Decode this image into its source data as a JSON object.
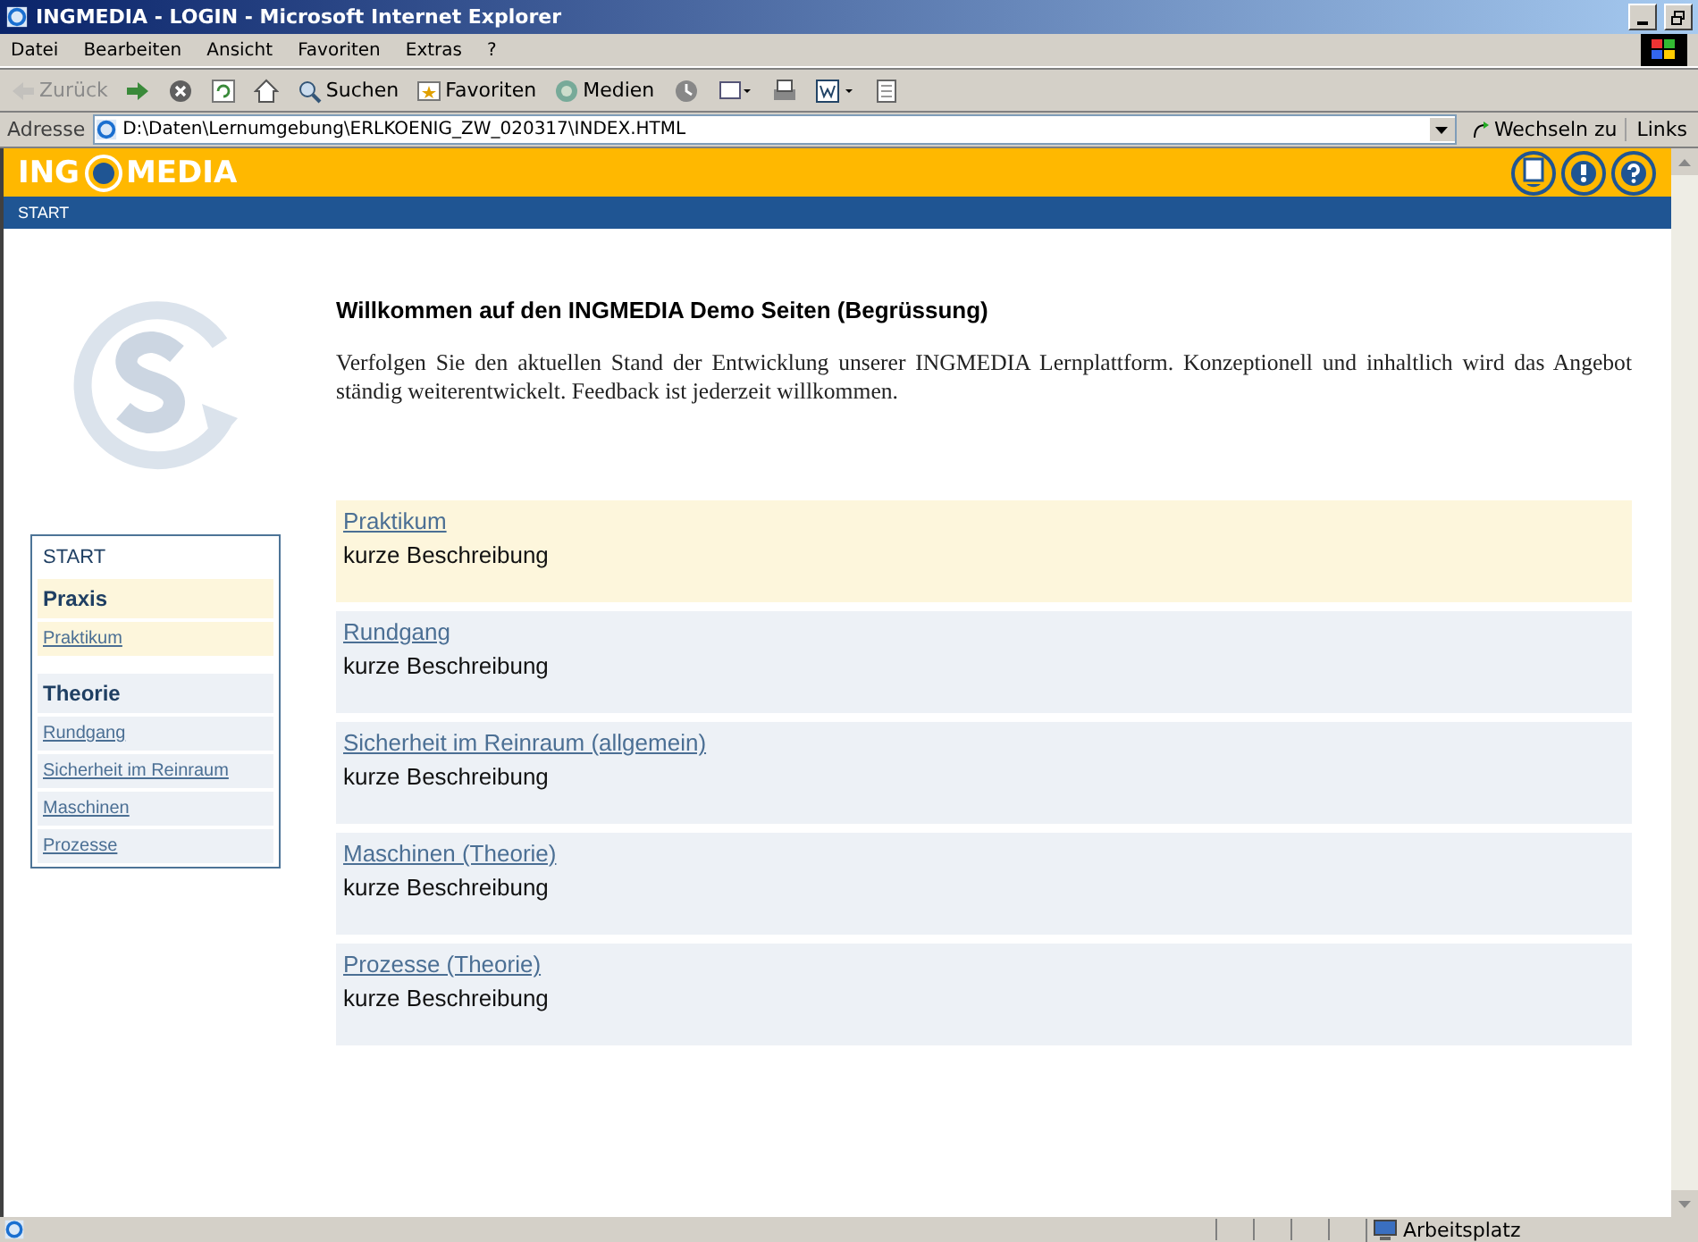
{
  "window": {
    "title": "INGMEDIA - LOGIN - Microsoft Internet Explorer"
  },
  "menu": [
    "Datei",
    "Bearbeiten",
    "Ansicht",
    "Favoriten",
    "Extras",
    "?"
  ],
  "toolbar": [
    {
      "kind": "back",
      "label": "Zurück",
      "disabled": true
    },
    {
      "kind": "forward",
      "disabled": false
    },
    {
      "kind": "stop",
      "disabled": false
    },
    {
      "kind": "refresh",
      "disabled": false
    },
    {
      "kind": "home",
      "disabled": false
    },
    {
      "kind": "search",
      "label": "Suchen",
      "disabled": false
    },
    {
      "kind": "favorites",
      "label": "Favoriten",
      "disabled": false
    },
    {
      "kind": "media",
      "label": "Medien",
      "disabled": false
    },
    {
      "kind": "history",
      "disabled": false
    },
    {
      "kind": "mail",
      "disabled": false
    },
    {
      "kind": "print",
      "disabled": false
    },
    {
      "kind": "word",
      "disabled": false
    },
    {
      "kind": "discuss",
      "disabled": false
    }
  ],
  "address_bar": {
    "label": "Adresse",
    "value": "D:\\Daten\\Lernumgebung\\ERLKOENIG_ZW_020317\\INDEX.HTML",
    "go": "Wechseln zu",
    "links": "Links"
  },
  "site": {
    "logo_left": "ING",
    "logo_right": "MEDIA",
    "nav": "START"
  },
  "sidebar": {
    "home": "START",
    "groups": [
      {
        "title": "Praxis",
        "selected": true,
        "items": [
          "Praktikum"
        ]
      },
      {
        "title": "Theorie",
        "selected": false,
        "items": [
          "Rundgang",
          "Sicherheit im Reinraum",
          "Maschinen",
          "Prozesse"
        ]
      }
    ]
  },
  "content": {
    "heading": "Willkommen auf den INGMEDIA Demo Seiten (Begrüssung)",
    "text": "Verfolgen Sie den aktuellen Stand der Entwicklung unserer INGMEDIA Lernplattform. Konzeptionell und inhaltlich wird das Angebot ständig weiterentwickelt. Feedback ist jederzeit willkommen."
  },
  "cards": [
    {
      "title": "Praktikum",
      "description": "kurze Beschreibung",
      "selected": true
    },
    {
      "title": "Rundgang",
      "description": "kurze Beschreibung",
      "selected": false
    },
    {
      "title": "Sicherheit im Reinraum (allgemein)",
      "description": "kurze Beschreibung",
      "selected": false
    },
    {
      "title": "Maschinen (Theorie)",
      "description": "kurze Beschreibung",
      "selected": false
    },
    {
      "title": "Prozesse (Theorie)",
      "description": "kurze Beschreibung",
      "selected": false
    }
  ],
  "status_bar": {
    "zone": "Arbeitsplatz"
  }
}
